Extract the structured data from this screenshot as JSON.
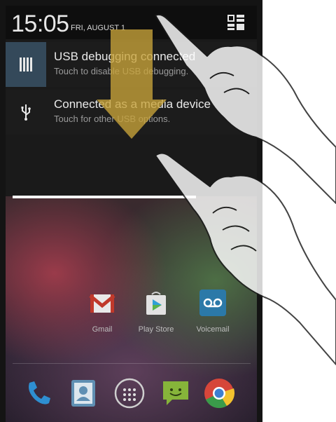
{
  "status": {
    "time": "15:05",
    "date": "FRI, AUGUST 1",
    "settings_icon": "quick-settings-icon"
  },
  "notifications": [
    {
      "icon": "usb-debugging-icon",
      "title": "USB debugging connected",
      "subtitle": "Touch to disable USB debugging."
    },
    {
      "icon": "usb-icon",
      "title": "Connected as a media device",
      "subtitle": "Touch for other USB options."
    }
  ],
  "home": {
    "apps": [
      {
        "label": "Gmail",
        "icon": "gmail-icon"
      },
      {
        "label": "Play Store",
        "icon": "play-store-icon"
      },
      {
        "label": "Voicemail",
        "icon": "voicemail-icon"
      }
    ],
    "dock": [
      "phone-icon",
      "contacts-icon",
      "app-drawer-icon",
      "messaging-icon",
      "chrome-icon"
    ]
  },
  "overlay": {
    "gesture": "swipe-down",
    "arrow_color": "#c9a43a"
  }
}
